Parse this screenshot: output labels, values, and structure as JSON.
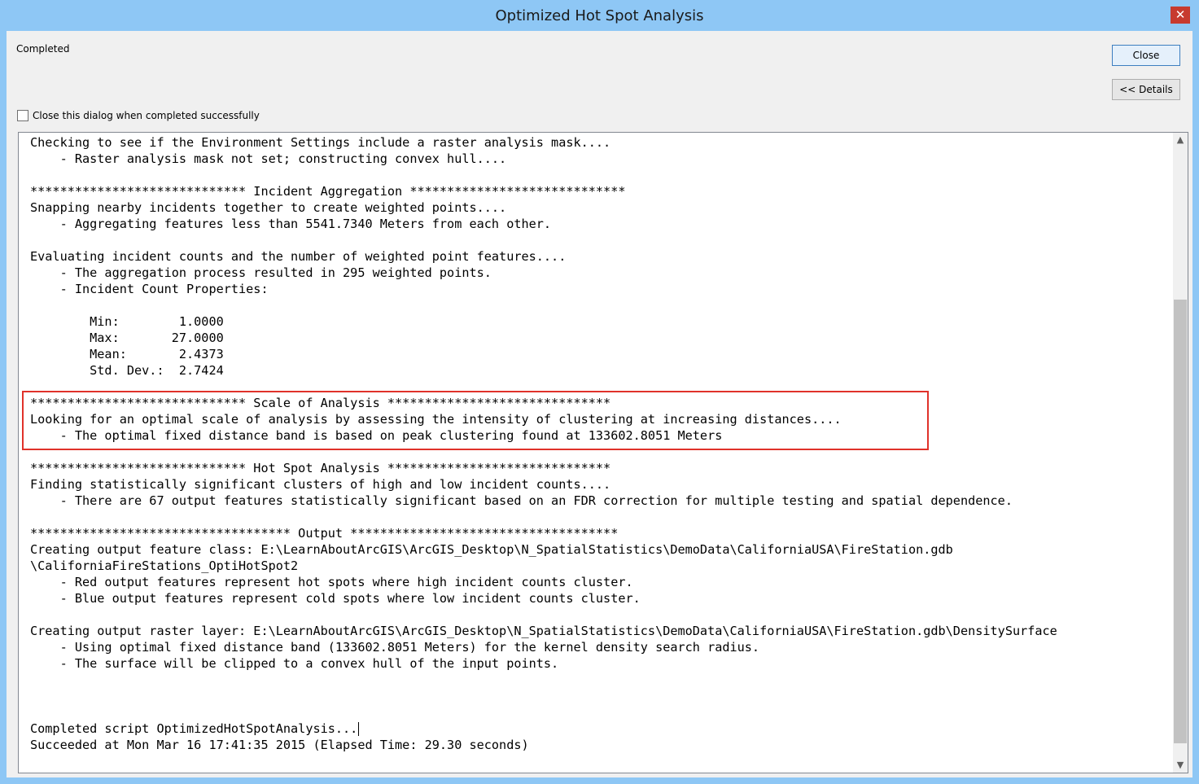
{
  "window": {
    "title": "Optimized Hot Spot Analysis",
    "close_glyph": "✕"
  },
  "status": {
    "text": "Completed"
  },
  "buttons": {
    "close_label": "Close",
    "details_label": "<< Details"
  },
  "option": {
    "close_when_done_label": "Close this dialog when completed successfully",
    "checked": false
  },
  "log": {
    "lines": [
      "Checking to see if the Environment Settings include a raster analysis mask....",
      "    - Raster analysis mask not set; constructing convex hull....",
      "",
      "***************************** Incident Aggregation *****************************",
      "Snapping nearby incidents together to create weighted points....",
      "    - Aggregating features less than 5541.7340 Meters from each other.",
      "",
      "Evaluating incident counts and the number of weighted point features....",
      "    - The aggregation process resulted in 295 weighted points.",
      "    - Incident Count Properties:",
      "",
      "        Min:        1.0000",
      "        Max:       27.0000",
      "        Mean:       2.4373",
      "        Std. Dev.:  2.7424",
      "",
      "***************************** Scale of Analysis ******************************",
      "Looking for an optimal scale of analysis by assessing the intensity of clustering at increasing distances....",
      "    - The optimal fixed distance band is based on peak clustering found at 133602.8051 Meters",
      "",
      "***************************** Hot Spot Analysis ******************************",
      "Finding statistically significant clusters of high and low incident counts....",
      "    - There are 67 output features statistically significant based on an FDR correction for multiple testing and spatial dependence.",
      "",
      "*********************************** Output ************************************",
      "Creating output feature class: E:\\LearnAboutArcGIS\\ArcGIS_Desktop\\N_SpatialStatistics\\DemoData\\CaliforniaUSA\\FireStation.gdb",
      "\\CaliforniaFireStations_OptiHotSpot2",
      "    - Red output features represent hot spots where high incident counts cluster.",
      "    - Blue output features represent cold spots where low incident counts cluster.",
      "",
      "Creating output raster layer: E:\\LearnAboutArcGIS\\ArcGIS_Desktop\\N_SpatialStatistics\\DemoData\\CaliforniaUSA\\FireStation.gdb\\DensitySurface",
      "    - Using optimal fixed distance band (133602.8051 Meters) for the kernel density search radius.",
      "    - The surface will be clipped to a convex hull of the input points.",
      "",
      "",
      "",
      "Completed script OptimizedHotSpotAnalysis...",
      "Succeeded at Mon Mar 16 17:41:35 2015 (Elapsed Time: 29.30 seconds)"
    ]
  },
  "scrollbar": {
    "up_icon": "scroll-up-arrow",
    "down_icon": "scroll-down-arrow"
  },
  "colors": {
    "title_bar": "#8ec7f5",
    "close_button": "#c73a2f",
    "highlight_border": "#e0322a"
  }
}
